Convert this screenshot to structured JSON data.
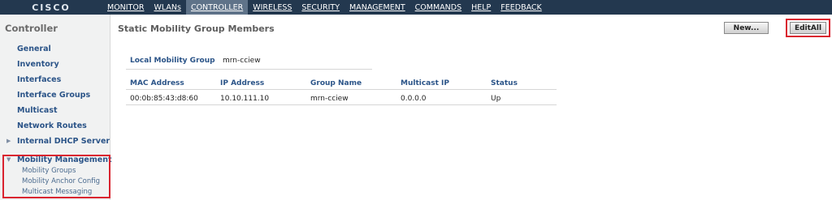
{
  "header": {
    "logo": "CISCO",
    "menu": [
      {
        "label": "MONITOR"
      },
      {
        "label": "WLANs"
      },
      {
        "label": "CONTROLLER",
        "active": true
      },
      {
        "label": "WIRELESS"
      },
      {
        "label": "SECURITY"
      },
      {
        "label": "MANAGEMENT"
      },
      {
        "label": "COMMANDS"
      },
      {
        "label": "HELP"
      },
      {
        "label": "FEEDBACK"
      }
    ]
  },
  "sidebar": {
    "title": "Controller",
    "items": [
      {
        "label": "General"
      },
      {
        "label": "Inventory"
      },
      {
        "label": "Interfaces"
      },
      {
        "label": "Interface Groups"
      },
      {
        "label": "Multicast"
      },
      {
        "label": "Network Routes"
      },
      {
        "label": "Internal DHCP Server"
      },
      {
        "label": "Mobility Management"
      }
    ],
    "subitems": [
      {
        "label": "Mobility Groups"
      },
      {
        "label": "Mobility Anchor Config"
      },
      {
        "label": "Multicast Messaging"
      }
    ],
    "arrows": {
      "collapsed": "▶",
      "expanded": "▼"
    }
  },
  "main": {
    "title": "Static Mobility Group Members",
    "buttons": {
      "new": "New...",
      "edit_all": "EditAll"
    },
    "local_mobility_group": {
      "label": "Local Mobility Group",
      "value": "mrn-cciew"
    },
    "table": {
      "headers": [
        "MAC Address",
        "IP Address",
        "Group Name",
        "Multicast IP",
        "Status"
      ],
      "rows": [
        [
          "00:0b:85:43:d8:60",
          "10.10.111.10",
          "mrn-cciew",
          "0.0.0.0",
          "Up"
        ]
      ]
    }
  },
  "colors": {
    "topbar": "#23384f",
    "active_menu": "#5f7389",
    "link": "#2b5488",
    "highlight": "#d9232f"
  }
}
